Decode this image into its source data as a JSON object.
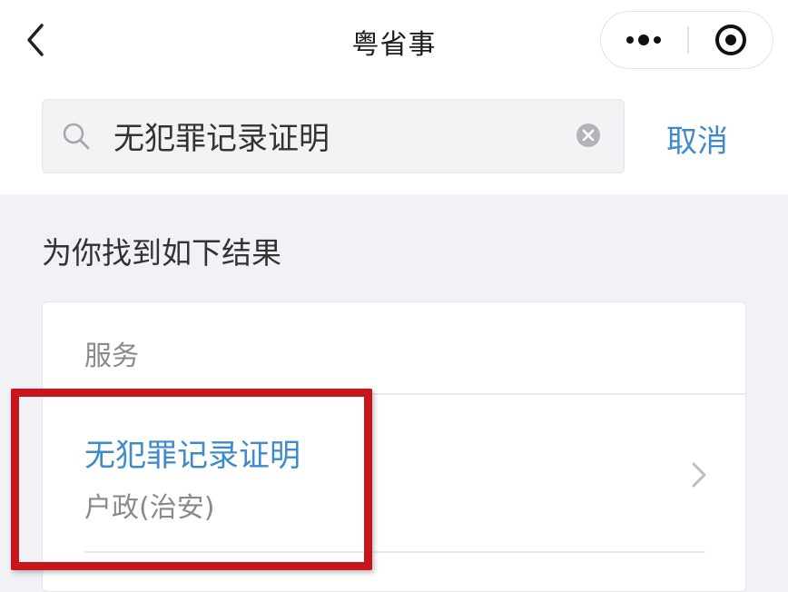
{
  "nav": {
    "title": "粤省事"
  },
  "search": {
    "value": "无犯罪记录证明",
    "cancel_label": "取消"
  },
  "results": {
    "heading": "为你找到如下结果",
    "section_label": "服务",
    "items": [
      {
        "title": "无犯罪记录证明",
        "subtitle": "户政(治安)"
      }
    ]
  },
  "colors": {
    "accent": "#3f8bc9",
    "highlight": "#c5161c",
    "background": "#f1f2f6"
  },
  "icons": {
    "back": "chevron-left-icon",
    "more": "more-dots-icon",
    "close": "target-circle-icon",
    "search": "search-icon",
    "clear": "clear-icon",
    "chevron": "chevron-right-icon"
  }
}
